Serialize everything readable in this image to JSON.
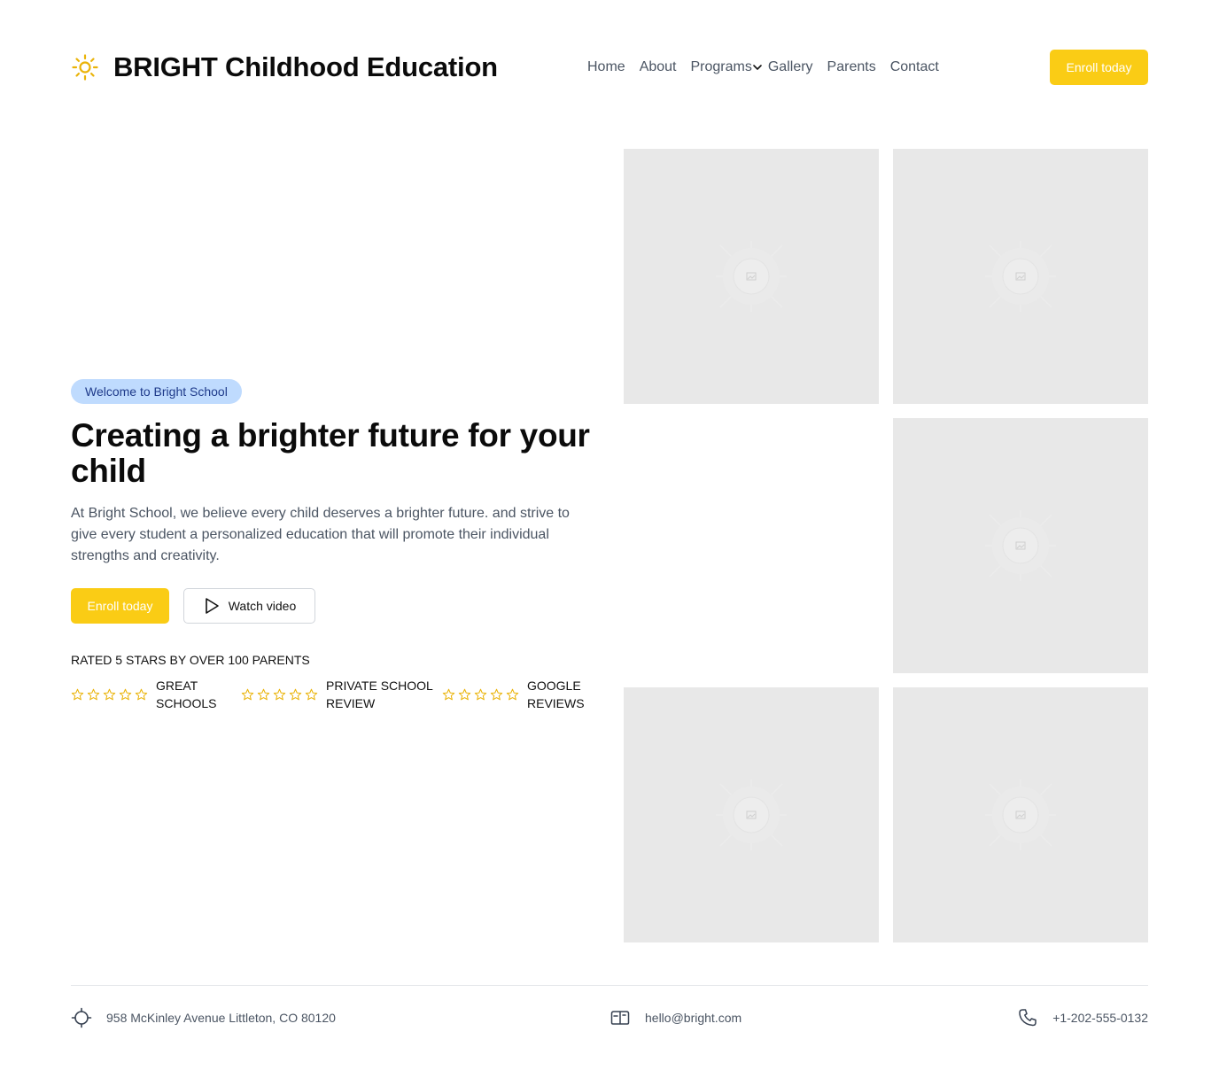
{
  "header": {
    "brand_title": "BRIGHT Childhood Education",
    "nav": [
      "Home",
      "About",
      "Programs",
      "Gallery",
      "Parents",
      "Contact"
    ],
    "cta_label": "Enroll today"
  },
  "hero": {
    "badge": "Welcome to Bright School",
    "headline": "Creating a brighter future for your child",
    "description": "At Bright School, we believe every child deserves a brighter future. and strive to give every student a personalized education that will promote their individual strengths and creativity.",
    "primary_cta": "Enroll today",
    "secondary_cta": "Watch video",
    "rated_text": "RATED 5 STARS BY OVER 100 PARENTS",
    "reviews": [
      {
        "label": "GREAT SCHOOLS",
        "stars": 5
      },
      {
        "label": "PRIVATE SCHOOL REVIEW",
        "stars": 5
      },
      {
        "label": "GOOGLE REVIEWS",
        "stars": 5
      }
    ]
  },
  "gallery": {
    "tiles": [
      "image-placeholder",
      "image-placeholder",
      "image-placeholder",
      "image-placeholder",
      "image-placeholder"
    ]
  },
  "footer": {
    "address": "958 McKinley Avenue Littleton, CO 80120",
    "email": "hello@bright.com",
    "phone": "+1-202-555-0132"
  },
  "colors": {
    "accent": "#facc15",
    "badge_bg": "#bfdbfe",
    "badge_text": "#1e3a8a",
    "muted_text": "#4b5563",
    "placeholder_bg": "#e8e8e8"
  },
  "icons": {
    "logo": "sun-icon",
    "nav_dropdown": "chevron-down-icon",
    "video": "play-icon",
    "rating": "star-outline-icon",
    "address": "location-crosshair-icon",
    "email": "mailbox-icon",
    "phone": "phone-icon"
  }
}
